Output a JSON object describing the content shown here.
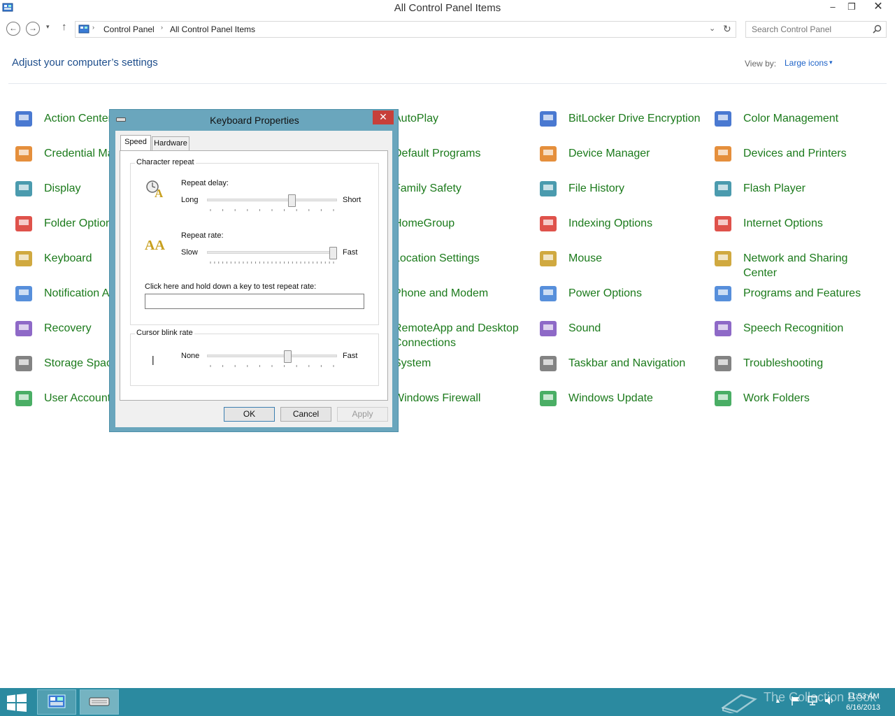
{
  "window": {
    "title": "All Control Panel Items",
    "minimize": "–",
    "maximize": "❐",
    "close": "✕"
  },
  "nav": {
    "back": "←",
    "forward": "→",
    "recent": "▾",
    "up": "↑",
    "breadcrumb": [
      "Control Panel",
      "All Control Panel Items"
    ],
    "separator": "›",
    "dropdown": "⌄",
    "refresh": "↻"
  },
  "search": {
    "placeholder": "Search Control Panel"
  },
  "header": {
    "title": "Adjust your computer’s settings",
    "viewby_label": "View by:",
    "viewby_value": "Large icons",
    "viewby_arrow": "▾"
  },
  "items": [
    {
      "label": "Action Center",
      "icon": "flag-icon"
    },
    {
      "label": "Credential Manager",
      "icon": "vault-icon"
    },
    {
      "label": "Display",
      "icon": "monitor-icon"
    },
    {
      "label": "Folder Options",
      "icon": "folder-options-icon"
    },
    {
      "label": "Keyboard",
      "icon": "keyboard-icon"
    },
    {
      "label": "Notification Area Icons",
      "icon": "notification-icon"
    },
    {
      "label": "Recovery",
      "icon": "recovery-icon"
    },
    {
      "label": "Storage Spaces",
      "icon": "storage-icon"
    },
    {
      "label": "User Accounts",
      "icon": "users-icon"
    },
    {
      "label": "AutoPlay",
      "icon": "autoplay-icon"
    },
    {
      "label": "Default Programs",
      "icon": "default-programs-icon"
    },
    {
      "label": "Family Safety",
      "icon": "family-icon"
    },
    {
      "label": "HomeGroup",
      "icon": "homegroup-icon"
    },
    {
      "label": "Location Settings",
      "icon": "location-icon"
    },
    {
      "label": "Phone and Modem",
      "icon": "phone-icon"
    },
    {
      "label": "RemoteApp and Desktop Connections",
      "icon": "remote-icon"
    },
    {
      "label": "System",
      "icon": "system-icon"
    },
    {
      "label": "Windows Firewall",
      "icon": "firewall-icon"
    },
    {
      "label": "BitLocker Drive Encryption",
      "icon": "bitlocker-icon"
    },
    {
      "label": "Device Manager",
      "icon": "device-manager-icon"
    },
    {
      "label": "File History",
      "icon": "file-history-icon"
    },
    {
      "label": "Indexing Options",
      "icon": "indexing-icon"
    },
    {
      "label": "Mouse",
      "icon": "mouse-icon"
    },
    {
      "label": "Power Options",
      "icon": "power-icon"
    },
    {
      "label": "Sound",
      "icon": "sound-icon"
    },
    {
      "label": "Taskbar and Navigation",
      "icon": "taskbar-icon"
    },
    {
      "label": "Windows Update",
      "icon": "update-icon"
    },
    {
      "label": "Color Management",
      "icon": "color-icon"
    },
    {
      "label": "Devices and Printers",
      "icon": "printer-icon"
    },
    {
      "label": "Flash Player",
      "icon": "flash-icon"
    },
    {
      "label": "Internet Options",
      "icon": "internet-icon"
    },
    {
      "label": "Network and Sharing Center",
      "icon": "network-icon"
    },
    {
      "label": "Programs and Features",
      "icon": "programs-icon"
    },
    {
      "label": "Speech Recognition",
      "icon": "microphone-icon"
    },
    {
      "label": "Troubleshooting",
      "icon": "troubleshoot-icon"
    },
    {
      "label": "Work Folders",
      "icon": "work-folders-icon"
    }
  ],
  "dialog": {
    "title": "Keyboard Properties",
    "close": "✕",
    "tabs": [
      "Speed",
      "Hardware"
    ],
    "char_repeat": {
      "title": "Character repeat",
      "delay_label": "Repeat delay:",
      "delay_min": "Long",
      "delay_max": "Short",
      "delay_value": 0.66,
      "rate_label": "Repeat rate:",
      "rate_min": "Slow",
      "rate_max": "Fast",
      "rate_value": 1.0,
      "test_label": "Click here and hold down a key to test repeat rate:",
      "test_value": ""
    },
    "cursor_blink": {
      "title": "Cursor blink rate",
      "cursor": "|",
      "min": "None",
      "max": "Fast",
      "value": 0.63
    },
    "buttons": {
      "ok": "OK",
      "cancel": "Cancel",
      "apply": "Apply"
    }
  },
  "taskbar": {
    "time": "11:53 AM",
    "date": "6/16/2013",
    "watermark": "The Collection Book",
    "tray_arrow": "▲"
  }
}
